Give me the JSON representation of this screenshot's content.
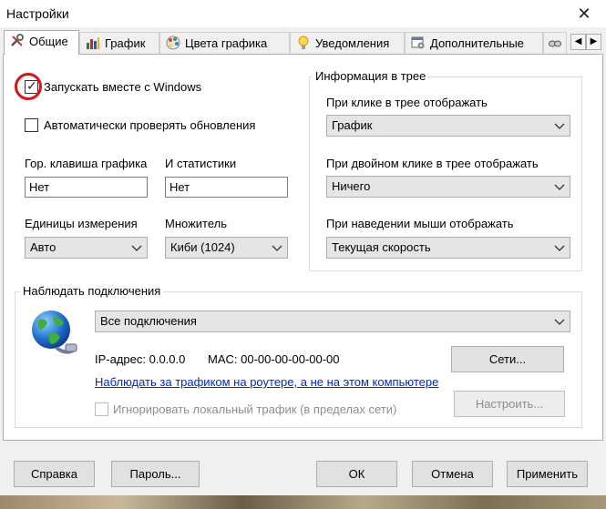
{
  "window": {
    "title": "Настройки",
    "close": "✕"
  },
  "tabs": [
    {
      "label": "Общие",
      "icon": "tools-icon"
    },
    {
      "label": "График",
      "icon": "bar-chart-icon"
    },
    {
      "label": "Цвета графика",
      "icon": "palette-icon"
    },
    {
      "label": "Уведомления",
      "icon": "lightbulb-icon"
    },
    {
      "label": "Дополнительные",
      "icon": "settings-window-icon"
    }
  ],
  "tab_scroll": {
    "left": "◀",
    "right": "▶"
  },
  "general": {
    "autostart": {
      "label": "Запускать вместе с Windows",
      "checked": true
    },
    "check_updates": {
      "label": "Автоматически проверять обновления",
      "checked": false
    },
    "hotkey_graph": {
      "label": "Гор. клавиша графика",
      "value": "Нет"
    },
    "hotkey_stats": {
      "label": "И статистики",
      "value": "Нет"
    },
    "units": {
      "label": "Единицы измерения",
      "value": "Авто"
    },
    "multiplier": {
      "label": "Множитель",
      "value": "Киби (1024)"
    }
  },
  "tray": {
    "group_title": "Информация в трее",
    "click": {
      "label": "При клике в трее отображать",
      "value": "График"
    },
    "double_click": {
      "label": "При двойном клике в трее отображать",
      "value": "Ничего"
    },
    "hover": {
      "label": "При наведении мыши отображать",
      "value": "Текущая скорость"
    }
  },
  "connections": {
    "group_title": "Наблюдать подключения",
    "select_value": "Все подключения",
    "ip_label": "IP-адрес: 0.0.0.0",
    "mac_label": "MAC: 00-00-00-00-00-00",
    "networks_button": "Сети...",
    "router_link": "Наблюдать за трафиком на роутере, а не на этом компьютере",
    "ignore_local": {
      "label": "Игнорировать локальный трафик (в пределах сети)",
      "checked": false,
      "disabled": true
    },
    "configure_button": "Настроить..."
  },
  "footer": {
    "help": "Справка",
    "password": "Пароль...",
    "ok": "ОК",
    "cancel": "Отмена",
    "apply": "Применить"
  },
  "colors": {
    "link": "#0026d6",
    "highlight_circle": "#e01010"
  }
}
